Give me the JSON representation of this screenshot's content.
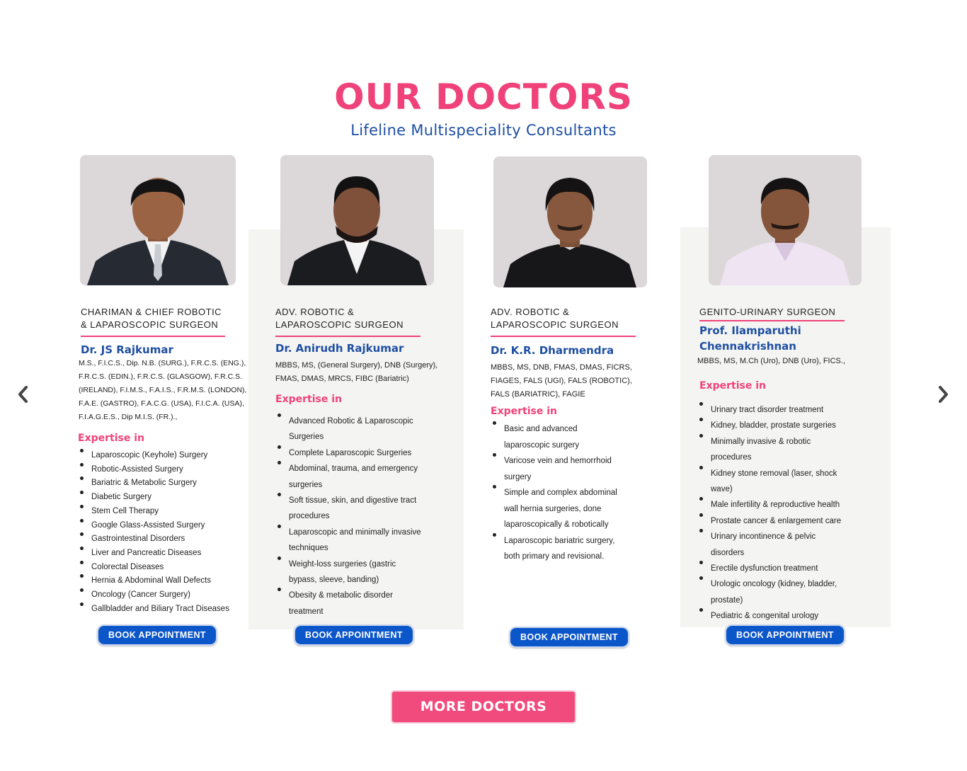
{
  "header": {
    "title": "OUR DOCTORS",
    "subtitle": "Lifeline Multispeciality Consultants"
  },
  "doctors": [
    {
      "role_line1": "CHARIMAN & CHIEF ROBOTIC",
      "role_line2": "& LAPAROSCOPIC SURGEON",
      "name_line1": "Dr. JS Rajkumar",
      "quals": [
        "M.S., F.I.C.S., Dip. N.B. (SURG.), F.R.C.S. (ENG.),",
        "F.R.C.S. (EDIN.), F.R.C.S. (GLASGOW), F.R.C.S.",
        "(IRELAND), F.I.M.S., F.A.I.S., F.R.M.S. (LONDON),",
        "F.A.E. (GASTRO), F.A.C.G. (USA), F.I.C.A. (USA),",
        "F.I.A.G.E.S., Dip M.I.S. (FR.).,"
      ],
      "expertise_title": "Expertise in",
      "expertise": [
        "Laparoscopic (Keyhole) Surgery",
        "Robotic-Assisted Surgery",
        "Bariatric & Metabolic Surgery",
        "Diabetic Surgery",
        "Stem Cell Therapy",
        "Google Glass-Assisted Surgery",
        "Gastrointestinal Disorders",
        "Liver and Pancreatic Diseases",
        "Colorectal Diseases",
        "Hernia & Abdominal Wall Defects",
        "Oncology (Cancer Surgery)",
        "Gallbladder and Biliary Tract Diseases"
      ],
      "book_label": "BOOK APPOINTMENT"
    },
    {
      "role_line1": "ADV. ROBOTIC &",
      "role_line2": "LAPAROSCOPIC SURGEON",
      "name_line1": "Dr. Anirudh Rajkumar",
      "quals": [
        "MBBS, MS, (General Surgery), DNB (Surgery),",
        "FMAS, DMAS, MRCS, FIBC (Bariatric)"
      ],
      "expertise_title": "Expertise in",
      "expertise": [
        "Advanced Robotic & Laparoscopic",
        "Surgeries",
        "Complete Laparoscopic Surgeries",
        "Abdominal, trauma, and emergency",
        "surgeries",
        "Soft tissue, skin, and digestive tract",
        "procedures",
        "Laparoscopic and minimally invasive",
        "techniques",
        "Weight-loss surgeries (gastric",
        "bypass, sleeve, banding)",
        "Obesity & metabolic disorder",
        "treatment"
      ],
      "book_label": "BOOK APPOINTMENT"
    },
    {
      "role_line1": "ADV. ROBOTIC &",
      "role_line2": "LAPAROSCOPIC SURGEON",
      "name_line1": "Dr. K.R. Dharmendra",
      "quals": [
        "MBBS, MS, DNB, FMAS, DMAS, FICRS,",
        "FIAGES, FALS (UGI), FALS (ROBOTIC),",
        "FALS (BARIATRIC), FAGIE"
      ],
      "expertise_title": "Expertise in",
      "expertise": [
        "Basic and advanced",
        "laparoscopic surgery",
        "Varicose vein and hemorrhoid",
        "surgery",
        "Simple and complex abdominal",
        "wall hernia surgeries, done",
        "laparoscopically & robotically",
        "Laparoscopic bariatric surgery,",
        "both primary and revisional."
      ],
      "book_label": "BOOK APPOINTMENT"
    },
    {
      "role_line1": "GENITO-URINARY SURGEON",
      "role_line2": "",
      "name_line1": "Prof. Ilamparuthi",
      "name_line2": "Chennakrishnan",
      "quals": [
        "MBBS, MS, M.Ch (Uro), DNB (Uro), FICS.,"
      ],
      "expertise_title": "Expertise in",
      "expertise": [
        "Urinary tract disorder treatment",
        "Kidney, bladder, prostate surgeries",
        "Minimally invasive & robotic",
        "procedures",
        "Kidney stone removal (laser, shock",
        "wave)",
        "Male infertility & reproductive health",
        "Prostate cancer & enlargement care",
        "Urinary incontinence & pelvic",
        "disorders",
        "Erectile dysfunction treatment",
        "Urologic oncology (kidney, bladder,",
        "prostate)",
        "Pediatric & congenital urology"
      ],
      "book_label": "BOOK APPOINTMENT"
    }
  ],
  "more_label": "MORE DOCTORS",
  "icons": {
    "prev": "chevron-left-icon",
    "next": "chevron-right-icon"
  },
  "colors": {
    "accent_pink": "#f0427a",
    "brand_blue": "#1e4fa3",
    "button_blue": "#0b56c9"
  }
}
